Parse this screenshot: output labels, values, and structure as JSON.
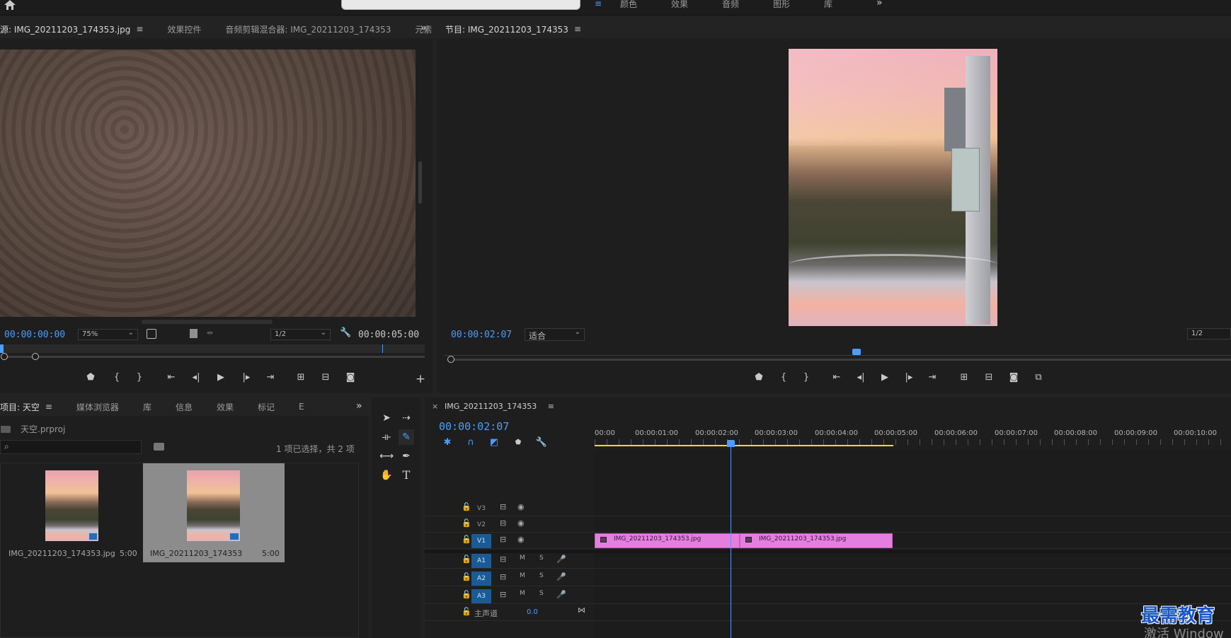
{
  "top_toolbar": {
    "workspaces": [
      "颜色",
      "效果",
      "音频",
      "图形",
      "库"
    ],
    "more": "»"
  },
  "source_panel": {
    "tabs": [
      {
        "label": "源: IMG_20211203_174353.jpg",
        "active": true
      },
      {
        "label": "效果控件"
      },
      {
        "label": "音频剪辑混合器: IMG_20211203_174353"
      },
      {
        "label": "元素"
      }
    ],
    "overflow": "»",
    "timecode_in": "00:00:00:00",
    "zoom": "75%",
    "resolution": "1/2",
    "timecode_out": "00:00:05:00",
    "add": "+"
  },
  "program_panel": {
    "tab_label": "节目: IMG_20211203_174353",
    "timecode": "00:00:02:07",
    "fit": "适合",
    "resolution": "1/2"
  },
  "project_panel": {
    "tabs": [
      {
        "label": "项目: 天空",
        "active": true
      },
      {
        "label": "媒体浏览器"
      },
      {
        "label": "库"
      },
      {
        "label": "信息"
      },
      {
        "label": "效果"
      },
      {
        "label": "标记"
      },
      {
        "label": "E"
      }
    ],
    "overflow": "»",
    "project_file": "天空.prproj",
    "search_placeholder": "",
    "selection_info": "1 项已选择，共 2 项",
    "items": [
      {
        "name": "IMG_20211203_174353.jpg",
        "duration": "5:00",
        "selected": false
      },
      {
        "name": "IMG_20211203_174353",
        "duration": "5:00",
        "selected": true
      }
    ]
  },
  "timeline_panel": {
    "close": "×",
    "sequence_name": "IMG_20211203_174353",
    "timecode": "00:00:02:07",
    "ruler": [
      "00:00",
      "00:00:01:00",
      "00:00:02:00",
      "00:00:03:00",
      "00:00:04:00",
      "00:00:05:00",
      "00:00:06:00",
      "00:00:07:00",
      "00:00:08:00",
      "00:00:09:00",
      "00:00:10:00"
    ],
    "video_tracks": [
      "V3",
      "V2",
      "V1"
    ],
    "audio_tracks": [
      "A1",
      "A2",
      "A3"
    ],
    "mute": "M",
    "solo": "S",
    "master_label": "主声道",
    "master_value": "0.0",
    "clips": [
      {
        "name": "IMG_20211203_174353.jpg"
      },
      {
        "name": "IMG_20211203_174353.jpg"
      }
    ]
  },
  "watermark": {
    "brand": "最需教育",
    "activate": "激活 Window"
  }
}
